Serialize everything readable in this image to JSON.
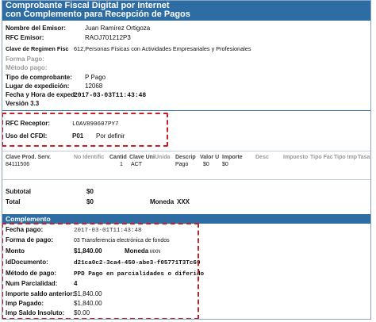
{
  "header": {
    "line1": "Comprobante Fiscal Digital por Internet",
    "line2": "con Complemento para Recepción de Pagos"
  },
  "emisor": [
    {
      "label": "Nombre del Emisor:",
      "value": "Juan Ramírez Ortigoza"
    },
    {
      "label": "RFC Emisor:",
      "value": "RAOJ701212P3"
    },
    {
      "label": "Clave de Regimen Fisc",
      "value": "612,Personas Físicas con Actividades Empresariales y Profesionales"
    },
    {
      "label": "Forma Pago:",
      "value": ""
    },
    {
      "label": "Método pago:",
      "value": ""
    },
    {
      "label": "Tipo de comprobante:",
      "value": "P  Pago"
    },
    {
      "label": "Lugar de expedición:",
      "value": "12068"
    },
    {
      "label": "Fecha y Hora de exped",
      "value": "2017-03-03T11:43:48"
    },
    {
      "label": "Versión 3.3",
      "value": ""
    }
  ],
  "receptor": {
    "rfc_label": "RFC Receptor:",
    "rfc_value": "LOAV890607PY7",
    "uso_label": "Uso del CFDI:",
    "uso_code": "P01",
    "uso_desc": "Por definir"
  },
  "concepts": {
    "headers": [
      "Clave Prod. Serv.",
      "No Identific",
      "Cantid",
      "Clave Uni",
      "Unida",
      "Descrip",
      "Valor U",
      "Importe",
      "Desc",
      "Impuesto",
      "Tipo Fac",
      "Tipo Imp",
      "Tasa"
    ],
    "row": {
      "clave": "84111506",
      "cantidad": "1",
      "clave_unidad": "ACT",
      "descripcion": "Pago",
      "valor": "$0",
      "importe": "$0"
    }
  },
  "totals": {
    "subtotal_label": "Subtotal",
    "subtotal_value": "$0",
    "total_label": "Total",
    "total_value": "$0",
    "moneda_label": "Moneda",
    "moneda_value": "XXX"
  },
  "complemento": {
    "title": "Complemento",
    "fields": [
      {
        "label": "Fecha pago:",
        "value": "2017-03-01T11:43:48"
      },
      {
        "label": "Forma de pago:",
        "value": "03 Transferencia electrónica de fondos"
      },
      {
        "label": "Monto",
        "value": "$1,840.00"
      },
      {
        "label": "IdDocumento:",
        "value": "d21ca0c2-3ca4-450-abe3-f05771T3Tc69"
      },
      {
        "label": "Método de pago:",
        "value": "PPD Pago en parcialidades o diferido"
      },
      {
        "label": "Num Parcialidad:",
        "value": "4"
      },
      {
        "label": "Importe saldo anterior:",
        "value": "$1,840.00"
      },
      {
        "label": "Imp Pagado:",
        "value": "$1,840.00"
      },
      {
        "label": "Imp Saldo Insoluto:",
        "value": "$0.00"
      }
    ],
    "moneda_label": "Moneda",
    "moneda_value": "MXN"
  },
  "colors": {
    "header_bg": "#2e6da4",
    "highlight": "#c81e25"
  }
}
